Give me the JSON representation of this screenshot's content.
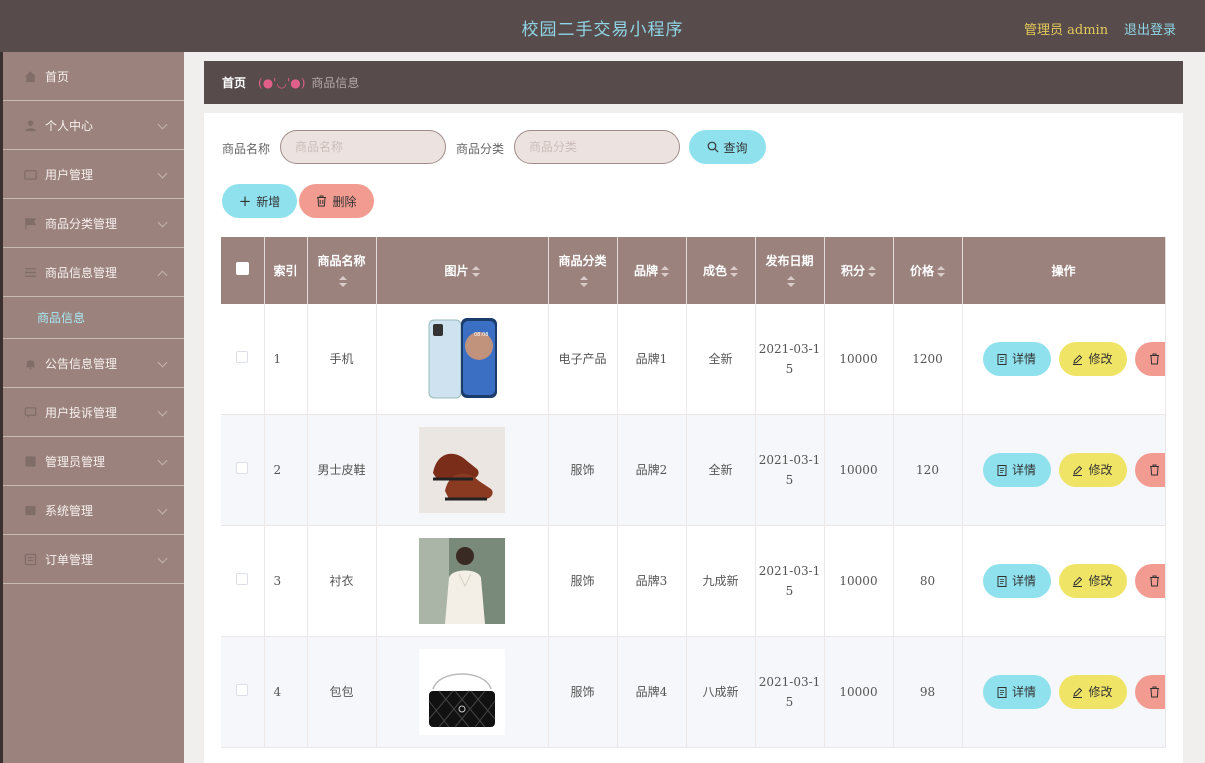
{
  "header": {
    "title": "校园二手交易小程序",
    "admin_label": "管理员 admin",
    "logout_label": "退出登录"
  },
  "sidebar": {
    "items": [
      {
        "label": "首页",
        "icon": "home-icon"
      },
      {
        "label": "个人中心",
        "icon": "user-icon"
      },
      {
        "label": "用户管理",
        "icon": "users-icon"
      },
      {
        "label": "商品分类管理",
        "icon": "flag-icon"
      },
      {
        "label": "商品信息管理",
        "icon": "list-icon"
      },
      {
        "label": "公告信息管理",
        "icon": "bell-icon"
      },
      {
        "label": "用户投诉管理",
        "icon": "complaint-icon"
      },
      {
        "label": "管理员管理",
        "icon": "admin-icon"
      },
      {
        "label": "系统管理",
        "icon": "settings-icon"
      },
      {
        "label": "订单管理",
        "icon": "order-icon"
      }
    ],
    "active_sub": "商品信息"
  },
  "breadcrumb": {
    "home": "首页",
    "sep": "(●'◡'●)",
    "current": "商品信息"
  },
  "search": {
    "name_label": "商品名称",
    "name_placeholder": "商品名称",
    "category_label": "商品分类",
    "category_placeholder": "商品分类",
    "query_label": "查询"
  },
  "actions": {
    "add_label": "新增",
    "delete_label": "删除"
  },
  "table": {
    "headers": {
      "index": "索引",
      "name": "商品名称",
      "image": "图片",
      "category": "商品分类",
      "brand": "品牌",
      "condition": "成色",
      "date": "发布日期",
      "points": "积分",
      "price": "价格",
      "ops": "操作"
    },
    "op_labels": {
      "detail": "详情",
      "edit": "修改",
      "delete": "删除"
    },
    "rows": [
      {
        "index": "1",
        "name": "手机",
        "category": "电子产品",
        "brand": "品牌1",
        "condition": "全新",
        "date_a": "2021-03-1",
        "date_b": "5",
        "points": "10000",
        "price": "1200",
        "image": "phone"
      },
      {
        "index": "2",
        "name": "男士皮鞋",
        "category": "服饰",
        "brand": "品牌2",
        "condition": "全新",
        "date_a": "2021-03-1",
        "date_b": "5",
        "points": "10000",
        "price": "120",
        "image": "shoes"
      },
      {
        "index": "3",
        "name": "衬衣",
        "category": "服饰",
        "brand": "品牌3",
        "condition": "九成新",
        "date_a": "2021-03-1",
        "date_b": "5",
        "points": "10000",
        "price": "80",
        "image": "shirt"
      },
      {
        "index": "4",
        "name": "包包",
        "category": "服饰",
        "brand": "品牌4",
        "condition": "八成新",
        "date_a": "2021-03-1",
        "date_b": "5",
        "points": "10000",
        "price": "98",
        "image": "bag"
      }
    ]
  },
  "colors": {
    "topbar": "#574b4b",
    "sidebar": "#9b827d",
    "accent_blue": "#8fe1ee",
    "accent_red": "#f29b91",
    "accent_yellow": "#f0e466"
  }
}
